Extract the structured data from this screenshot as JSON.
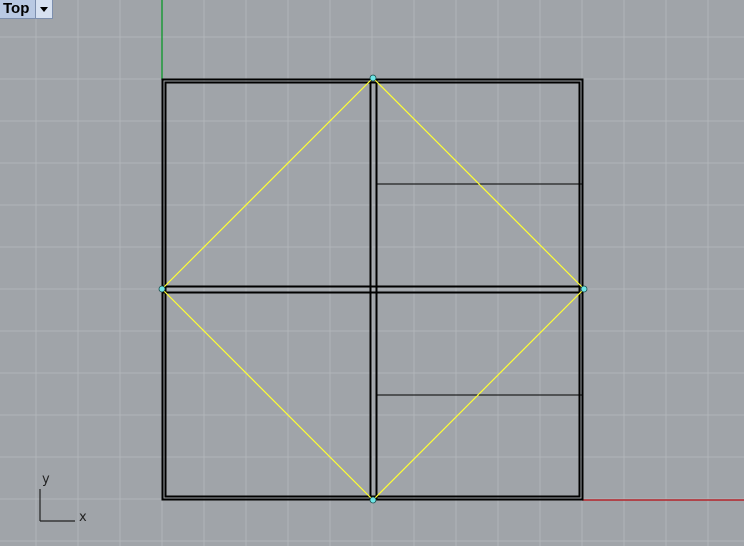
{
  "viewport": {
    "name": "Top",
    "background_color": "#a0a4a9",
    "grid_color": "#b1b5b9",
    "x_axis_color": "#b4252a",
    "y_axis_color": "#1f9a3a",
    "curve_color": "#ffff33",
    "geometry_color": "#000000",
    "point_color": "#6fe6e6"
  },
  "axes_widget": {
    "x_label": "x",
    "y_label": "y"
  },
  "view_menu_icon": "chevron-down-icon"
}
